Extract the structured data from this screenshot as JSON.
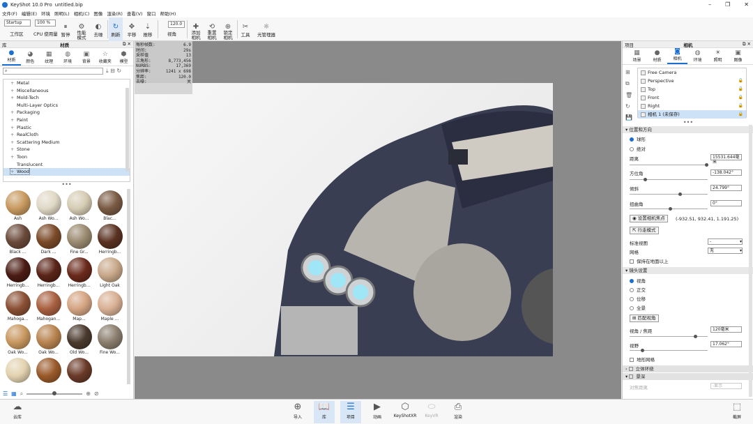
{
  "title": {
    "app": "KeyShot 10.0 Pro",
    "file": "untitled.bip"
  },
  "menu": [
    "文件(F)",
    "编辑(E)",
    "环境",
    "照明(L)",
    "相机(C)",
    "图像",
    "渲染(R)",
    "查看(V)",
    "窗口",
    "帮助(H)"
  ],
  "toolbar": {
    "workspace_select": "Startup",
    "workspace_label": "工作区",
    "cpu_select": "100 %",
    "cpu_label": "CPU 使用量",
    "pause": "暂停",
    "perf": "性能\n模式",
    "denoise": "去噪",
    "refresh": "刷新",
    "pan": "平移",
    "dolly": "推移",
    "fov_value": "120.0",
    "fov_label": "视角",
    "add_cam": "添加\n相机",
    "reset_cam": "重置\n相机",
    "lock_cam": "锁定\n相机",
    "tools": "工具",
    "light_mgr": "光管理器"
  },
  "library": {
    "header_left": "库",
    "header_center": "材质",
    "tabs": [
      "材质",
      "颜色",
      "纹理",
      "环境",
      "背景",
      "收藏夹",
      "模型"
    ],
    "tree": [
      "Metal",
      "Miscellaneous",
      "Mold-Tech",
      "Multi-Layer Optics",
      "Packaging",
      "Paint",
      "Plastic",
      "RealCloth",
      "Scattering Medium",
      "Stone",
      "Toon",
      "Translucent",
      "Wood"
    ],
    "tree_selected": "Wood",
    "materials": [
      {
        "name": "Ash",
        "color": "#c89a60"
      },
      {
        "name": "Ash Wo...",
        "color": "#e0d8c6"
      },
      {
        "name": "Ash Wo...",
        "color": "#d6ccb4"
      },
      {
        "name": "Blac...",
        "color": "#7a5a44"
      },
      {
        "name": "Black ...",
        "color": "#6a4a3a"
      },
      {
        "name": "Dark ...",
        "color": "#7a4a28"
      },
      {
        "name": "Fine Gr...",
        "color": "#9a8a70"
      },
      {
        "name": "Herringb...",
        "color": "#5a3222"
      },
      {
        "name": "Herringb...",
        "color": "#4a1c14"
      },
      {
        "name": "Herringb...",
        "color": "#5a2418"
      },
      {
        "name": "Herringb...",
        "color": "#6a2a1c"
      },
      {
        "name": "Light Oak",
        "color": "#c8a88a"
      },
      {
        "name": "Mahoga...",
        "color": "#8a5034"
      },
      {
        "name": "Mahogan...",
        "color": "#a86040"
      },
      {
        "name": "Map...",
        "color": "#d4a482"
      },
      {
        "name": "Maple ...",
        "color": "#d8b094"
      },
      {
        "name": "Oak Wo...",
        "color": "#c89860"
      },
      {
        "name": "Oak Wo...",
        "color": "#b88450"
      },
      {
        "name": "Old Wo...",
        "color": "#4a3a2e"
      },
      {
        "name": "Fine Wo...",
        "color": "#8a7e6e"
      },
      {
        "name": "",
        "color": "#e2d2b0"
      },
      {
        "name": "",
        "color": "#9a5a2a"
      },
      {
        "name": "",
        "color": "#6a3a28"
      }
    ]
  },
  "stats": [
    [
      "每秒帧数:",
      "6.9"
    ],
    [
      "时间:",
      "29s"
    ],
    [
      "采样值",
      "13"
    ],
    [
      "三角形:",
      "8,773,456"
    ],
    [
      "NURBS:",
      "17,369"
    ],
    [
      "分辨率:",
      "1241 x 698"
    ],
    [
      "焦距:",
      "120.0"
    ],
    [
      "去噪:",
      "关"
    ]
  ],
  "project": {
    "header_left": "项目",
    "header_center": "相机",
    "tabs": [
      "场景",
      "材质",
      "相机",
      "环境",
      "照明",
      "图像"
    ],
    "cameras": [
      {
        "name": "Free Camera",
        "lock": false
      },
      {
        "name": "Perspective",
        "lock": true
      },
      {
        "name": "Top",
        "lock": true
      },
      {
        "name": "Front",
        "lock": true
      },
      {
        "name": "Right",
        "lock": true
      },
      {
        "name": "相机 1 (未保存)",
        "lock": true
      }
    ],
    "pos_section": "位置和方向",
    "orbit": "球形",
    "absolute": "绝对",
    "distance_label": "距离",
    "distance": "15531.644毫米",
    "azimuth_label": "方位角",
    "azimuth": "-138.042°",
    "incline_label": "倾斜",
    "incline": "24.799°",
    "twist_label": "扭曲角",
    "twist": "0°",
    "set_focus_btn": "设置相机焦点",
    "focus_coords": "(-932.51, 932.41, 1.191.25)",
    "walk_mode_btn": "行走模式",
    "std_view_label": "标准视图",
    "std_view": "-",
    "grid_label": "网格",
    "grid": "无",
    "keep_above": "保持在地面以上",
    "lens_section": "镜头设置",
    "persp": "视角",
    "ortho": "正交",
    "shift": "位移",
    "panorama": "全景",
    "match_persp_btn": "匹配视角",
    "fov_label": "视角 / 焦距",
    "fov": "120毫米",
    "view_label": "视野",
    "view": "17.062°",
    "geo_grid": "地形网格",
    "stereo": "立体环绕",
    "dof": "景深",
    "focus_dist_label": "对焦距离",
    "focus_dist": "-显示"
  },
  "bottom": {
    "cloud": "云库",
    "import": "导入",
    "library": "库",
    "project": "项目",
    "animation": "动画",
    "keyshotxr": "KeyShotXR",
    "keyvr": "KeyVR",
    "render": "渲染",
    "expert": "截屏"
  }
}
